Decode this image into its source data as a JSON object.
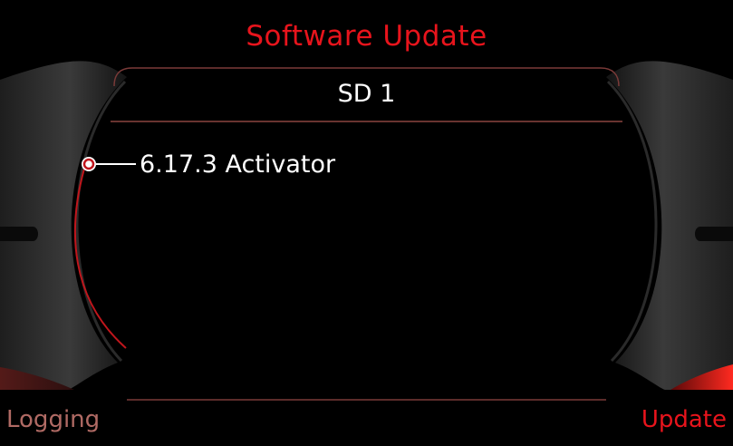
{
  "window": {
    "title": "Software Update"
  },
  "panel": {
    "header": "SD 1",
    "items": [
      {
        "label": "6.17.3 Activator",
        "selected": true
      }
    ]
  },
  "softkeys": {
    "left_label": "Logging",
    "right_label": "Update"
  },
  "colors": {
    "accent_red": "#e8141c",
    "dim_red": "#b06a64",
    "background": "#000000",
    "text": "#ffffff"
  },
  "icons": {
    "selection_marker": "selection-ring-icon"
  }
}
